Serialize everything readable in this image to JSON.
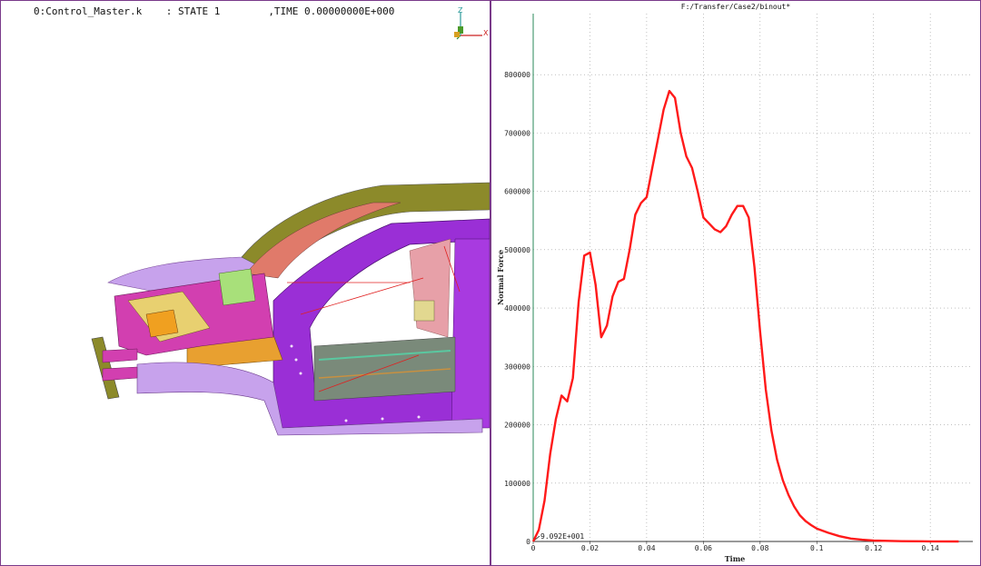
{
  "model_view": {
    "file_label": "0:Control_Master.k",
    "state_label": ": STATE 1",
    "time_label": ",TIME 0.00000000E+000",
    "axes": {
      "z_label": "Z",
      "x_label": "X"
    },
    "colors": {
      "body_purple": "#9a2fd6",
      "lilac": "#c7a2ec",
      "olive": "#8c8a2a",
      "salmon": "#e07a6a",
      "orange": "#e8a030",
      "magenta": "#d23fb0"
    }
  },
  "plot": {
    "title": "F:/Transfer/Case2/binout*",
    "min_marker": "9.092E+001",
    "curve_color": "#ff1a1a",
    "chart_data": {
      "type": "line",
      "xlabel": "Time",
      "ylabel": "Normal Force",
      "xlim": [
        0,
        0.15
      ],
      "ylim": [
        0,
        900000
      ],
      "x_ticks": [
        "0",
        "0.02",
        "0.04",
        "0.06",
        "0.08",
        "0.1",
        "0.12",
        "0.14"
      ],
      "y_ticks": [
        "0",
        "100000",
        "200000",
        "300000",
        "400000",
        "500000",
        "600000",
        "700000",
        "800000"
      ],
      "grid": true,
      "series": [
        {
          "x": [
            0,
            0.002,
            0.004,
            0.006,
            0.008,
            0.01,
            0.012,
            0.014,
            0.016,
            0.018,
            0.02,
            0.022,
            0.024,
            0.026,
            0.028,
            0.03,
            0.032,
            0.034,
            0.036,
            0.038,
            0.04,
            0.042,
            0.044,
            0.046,
            0.048,
            0.05,
            0.052,
            0.054,
            0.056,
            0.058,
            0.06,
            0.062,
            0.064,
            0.066,
            0.068,
            0.07,
            0.072,
            0.074,
            0.076,
            0.078,
            0.08,
            0.082,
            0.084,
            0.086,
            0.088,
            0.09,
            0.092,
            0.094,
            0.096,
            0.098,
            0.1,
            0.104,
            0.108,
            0.112,
            0.116,
            0.12,
            0.13,
            0.14,
            0.15
          ],
          "y": [
            0,
            20000,
            70000,
            150000,
            210000,
            250000,
            240000,
            280000,
            410000,
            490000,
            495000,
            440000,
            350000,
            370000,
            420000,
            445000,
            450000,
            500000,
            560000,
            580000,
            590000,
            640000,
            690000,
            740000,
            772000,
            760000,
            700000,
            660000,
            640000,
            600000,
            555000,
            545000,
            535000,
            530000,
            540000,
            560000,
            575000,
            575000,
            555000,
            470000,
            360000,
            260000,
            190000,
            140000,
            105000,
            80000,
            60000,
            45000,
            35000,
            28000,
            22000,
            15000,
            9000,
            5000,
            3000,
            1500,
            500,
            100,
            0
          ]
        }
      ]
    }
  }
}
